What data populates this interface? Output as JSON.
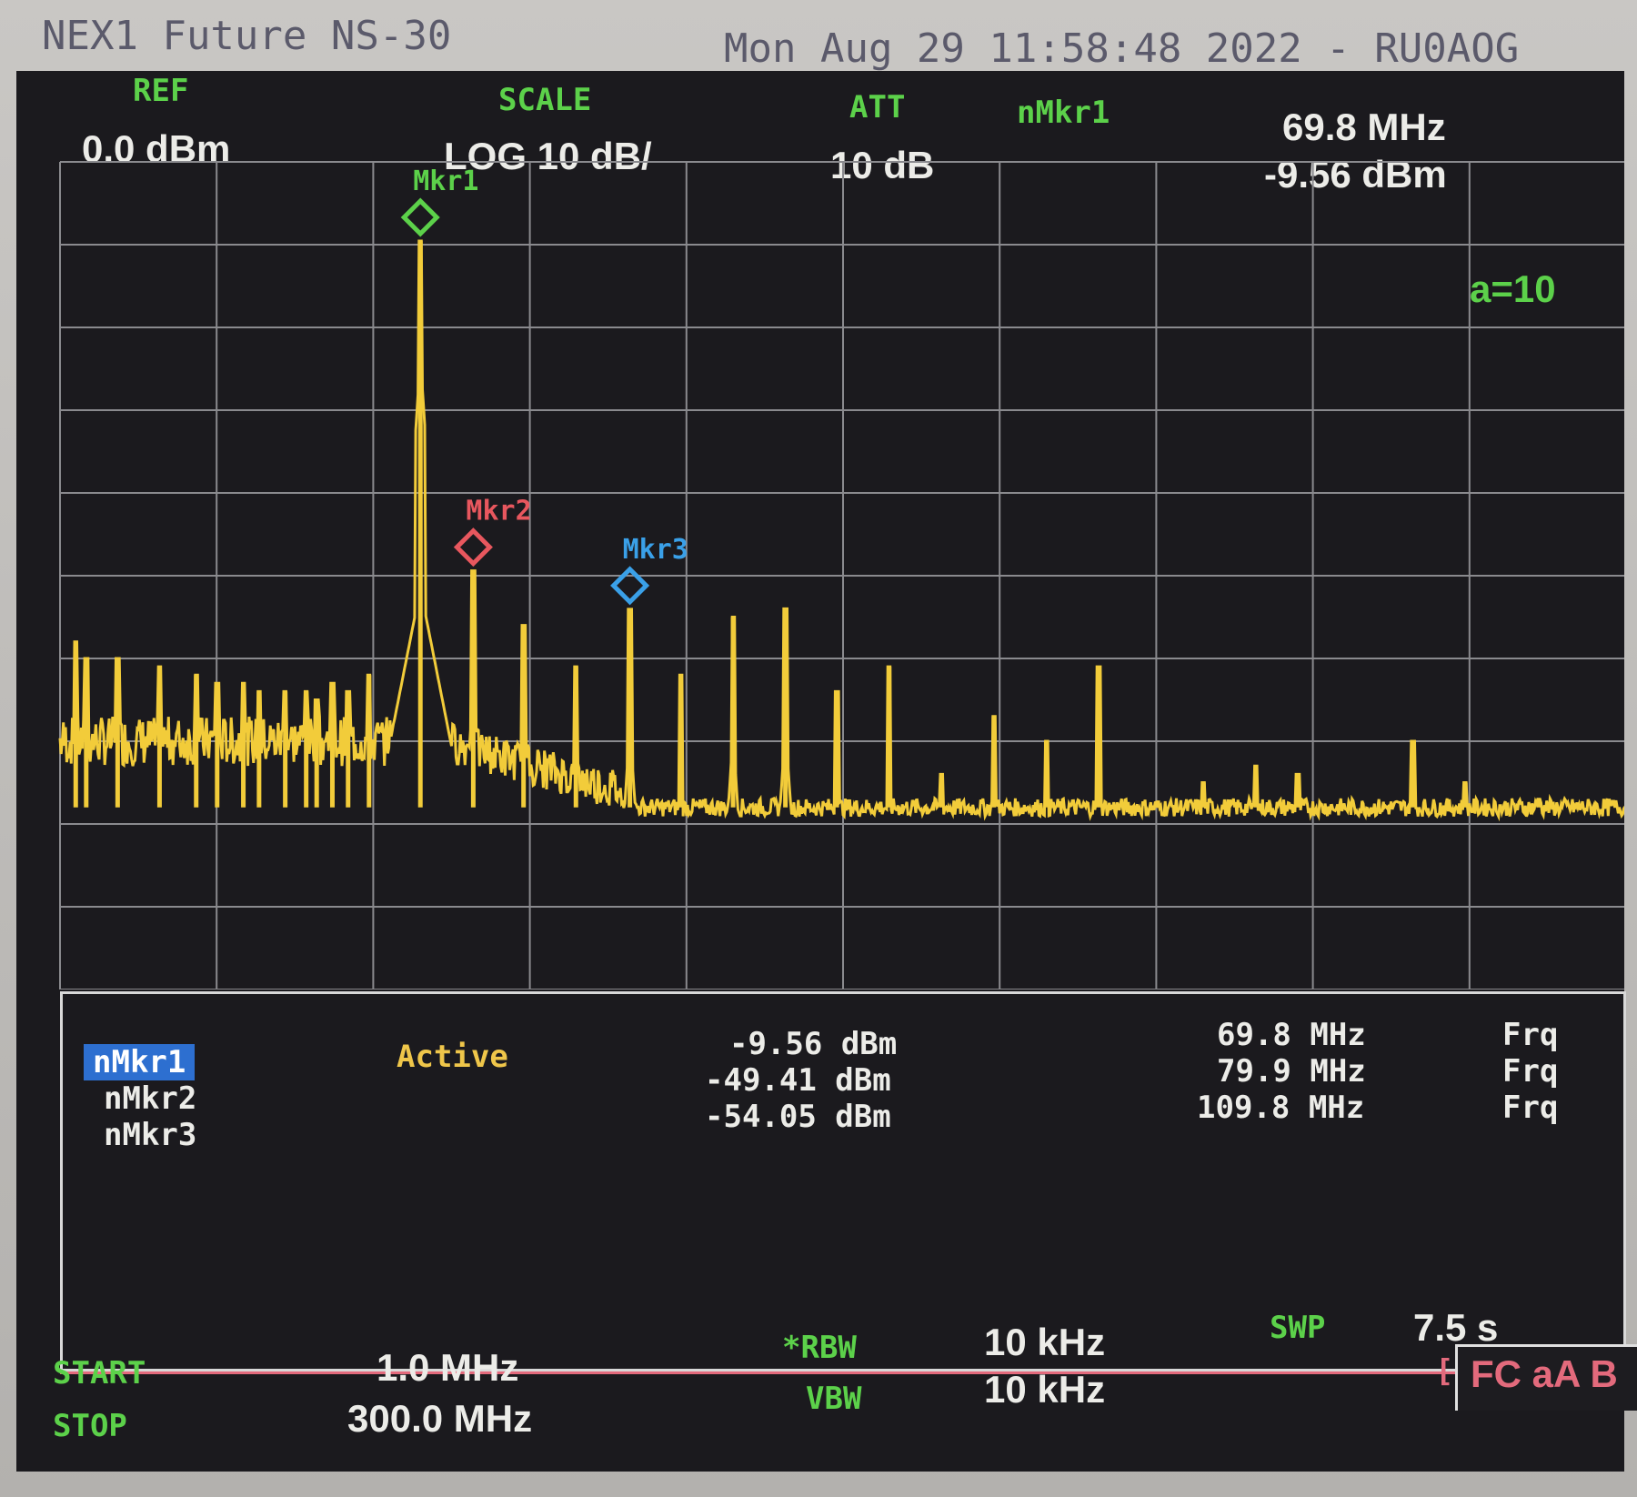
{
  "header": {
    "device_title": "NEX1 Future NS-30",
    "datetime": "Mon Aug 29 11:58:48 2022 - RU0AOG"
  },
  "top_params": {
    "ref_label": "REF",
    "ref_value": "0.0 dBm",
    "scale_label": "SCALE",
    "scale_value": "LOG 10 dB/",
    "att_label": "ATT",
    "att_value": "10 dB",
    "active_marker_label": "nMkr1",
    "active_marker_freq": "69.8 MHz",
    "active_marker_level": "-9.56 dBm"
  },
  "avg_indicator": "a=10",
  "markers_on_plot": [
    {
      "label": "Mkr1",
      "color": "#5cd14a"
    },
    {
      "label": "Mkr2",
      "color": "#e8575e"
    },
    {
      "label": "Mkr3",
      "color": "#3aa0e8"
    }
  ],
  "marker_table": {
    "status": "Active",
    "rows": [
      {
        "name": "nMkr1",
        "level": "-9.56 dBm",
        "freq": "69.8 MHz",
        "mode": "Frq",
        "selected": true
      },
      {
        "name": "nMkr2",
        "level": "-49.41 dBm",
        "freq": "79.9 MHz",
        "mode": "Frq",
        "selected": false
      },
      {
        "name": "nMkr3",
        "level": "-54.05 dBm",
        "freq": "109.8 MHz",
        "mode": "Frq",
        "selected": false
      }
    ]
  },
  "bottom_params": {
    "start_label": "START",
    "start_value": "1.0 MHz",
    "stop_label": "STOP",
    "stop_value": "300.0 MHz",
    "rbw_label": "*RBW",
    "rbw_value": "10 kHz",
    "vbw_label": "VBW",
    "vbw_value": "10 kHz",
    "swp_label": "SWP",
    "swp_value": "7.5 s",
    "swp_mode": "[int]",
    "status_box": "FC aA B"
  },
  "colors": {
    "trace": "#f2cc3a",
    "grid": "#8a8a8e",
    "screen_bg": "#1b1a1e",
    "label_green": "#5cd14a"
  },
  "chart_data": {
    "type": "line",
    "x_unit": "MHz",
    "y_unit": "dBm",
    "xlim": [
      1.0,
      300.0
    ],
    "ylim": [
      -100.0,
      0.0
    ],
    "grid": true,
    "x_divisions": 10,
    "y_divisions": 10,
    "noise_floor": -78,
    "peaks": [
      {
        "x": 4,
        "y": -58
      },
      {
        "x": 6,
        "y": -60
      },
      {
        "x": 12,
        "y": -60
      },
      {
        "x": 20,
        "y": -61
      },
      {
        "x": 27,
        "y": -62
      },
      {
        "x": 31,
        "y": -63
      },
      {
        "x": 36,
        "y": -63
      },
      {
        "x": 39,
        "y": -64
      },
      {
        "x": 44,
        "y": -64
      },
      {
        "x": 48,
        "y": -64
      },
      {
        "x": 50,
        "y": -65
      },
      {
        "x": 53,
        "y": -63
      },
      {
        "x": 56,
        "y": -64
      },
      {
        "x": 60,
        "y": -62
      },
      {
        "x": 69.8,
        "y": -9.56
      },
      {
        "x": 79.9,
        "y": -49.41
      },
      {
        "x": 89.5,
        "y": -56
      },
      {
        "x": 99.5,
        "y": -61
      },
      {
        "x": 109.8,
        "y": -54.05
      },
      {
        "x": 119.5,
        "y": -62
      },
      {
        "x": 129.5,
        "y": -55
      },
      {
        "x": 139.5,
        "y": -54
      },
      {
        "x": 149.3,
        "y": -64
      },
      {
        "x": 159.3,
        "y": -61
      },
      {
        "x": 169.3,
        "y": -74
      },
      {
        "x": 179.3,
        "y": -67
      },
      {
        "x": 189.3,
        "y": -70
      },
      {
        "x": 199.3,
        "y": -61
      },
      {
        "x": 219.3,
        "y": -75
      },
      {
        "x": 229.3,
        "y": -73
      },
      {
        "x": 237.3,
        "y": -74
      },
      {
        "x": 259.3,
        "y": -70
      },
      {
        "x": 269.3,
        "y": -75
      },
      {
        "x": 283.3,
        "y": -77
      }
    ],
    "markers": [
      {
        "name": "Mkr1",
        "x": 69.8,
        "y": -9.56
      },
      {
        "name": "Mkr2",
        "x": 79.9,
        "y": -49.41
      },
      {
        "name": "Mkr3",
        "x": 109.8,
        "y": -54.05
      }
    ]
  }
}
